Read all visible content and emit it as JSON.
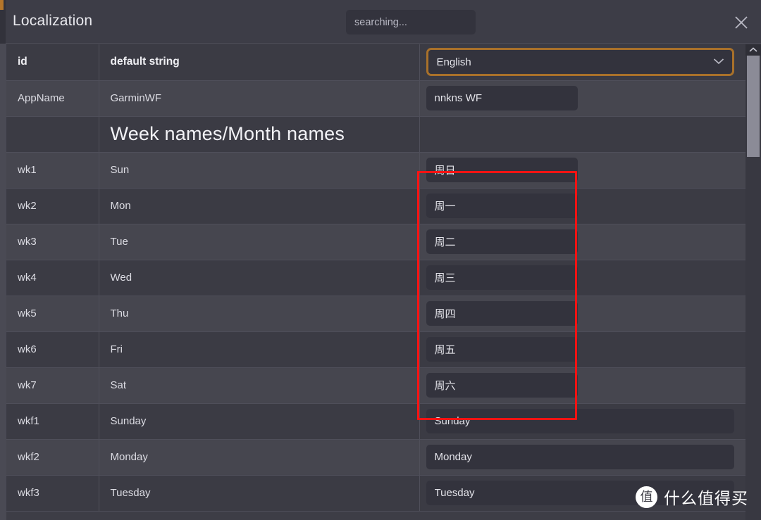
{
  "window": {
    "title": "Localization",
    "close_icon": "close-icon",
    "accent_color": "#b5762a"
  },
  "search": {
    "value": "",
    "placeholder": "searching..."
  },
  "scrollbar": {
    "up_arrow_icon": "chevron-up-icon",
    "thumb_position_percent": 0
  },
  "table": {
    "columns": [
      "id",
      "default string",
      ""
    ],
    "language_selector": {
      "value": "English",
      "chevron_icon": "chevron-down-icon",
      "options": [
        "English"
      ]
    },
    "rows": [
      {
        "id": "AppName",
        "default": "GarminWF",
        "value": "nnkns WF",
        "narrow": true
      },
      {
        "section": "Week names/Month names"
      },
      {
        "id": "wk1",
        "default": "Sun",
        "value": "周日",
        "narrow": true
      },
      {
        "id": "wk2",
        "default": "Mon",
        "value": "周一",
        "narrow": true
      },
      {
        "id": "wk3",
        "default": "Tue",
        "value": "周二",
        "narrow": true
      },
      {
        "id": "wk4",
        "default": "Wed",
        "value": "周三",
        "narrow": true
      },
      {
        "id": "wk5",
        "default": "Thu",
        "value": "周四",
        "narrow": true
      },
      {
        "id": "wk6",
        "default": "Fri",
        "value": "周五",
        "narrow": true
      },
      {
        "id": "wk7",
        "default": "Sat",
        "value": "周六",
        "narrow": true
      },
      {
        "id": "wkf1",
        "default": "Sunday",
        "value": "Sunday",
        "narrow": false
      },
      {
        "id": "wkf2",
        "default": "Monday",
        "value": "Monday",
        "narrow": false
      },
      {
        "id": "wkf3",
        "default": "Tuesday",
        "value": "Tuesday",
        "narrow": false
      }
    ]
  },
  "annotation": {
    "highlight_color": "#fb1313",
    "label": "week-name-translations-highlight"
  },
  "watermark": {
    "badge": "值",
    "text": "什么值得买"
  }
}
